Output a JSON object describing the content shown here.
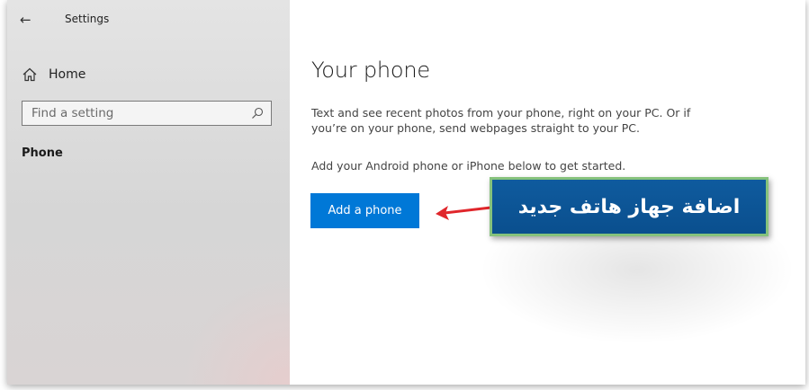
{
  "window": {
    "title": "Settings"
  },
  "sidebar": {
    "back_icon": "arrow-left-icon",
    "home_label": "Home",
    "home_icon": "home-icon",
    "search_placeholder": "Find a setting",
    "search_icon": "search-icon",
    "active_item": "Phone"
  },
  "main": {
    "title": "Your phone",
    "description": "Text and see recent photos from your phone, right on your PC. Or if you’re on your phone, send webpages straight to your PC.",
    "get_started": "Add your Android phone or iPhone below to get started.",
    "add_button_label": "Add a phone"
  },
  "annotation": {
    "callout_text": "اضافة جهاز هاتف جديد",
    "arrow_color": "#e0262b",
    "callout_bg": "#0a4f8e",
    "callout_border": "#86c27c"
  },
  "colors": {
    "accent": "#0078d7"
  }
}
